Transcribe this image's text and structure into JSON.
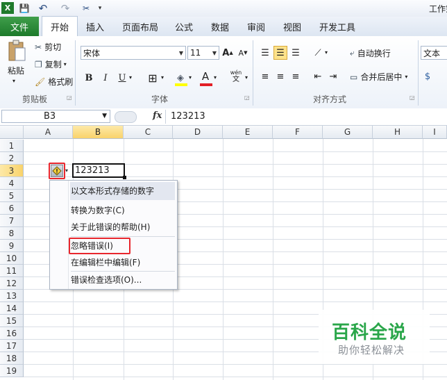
{
  "qat": {
    "save": "💾",
    "undo": "↶",
    "redo": "↷",
    "tools": "✂"
  },
  "window_title": "工作簿",
  "tabs": [
    {
      "label": "文件"
    },
    {
      "label": "开始"
    },
    {
      "label": "插入"
    },
    {
      "label": "页面布局"
    },
    {
      "label": "公式"
    },
    {
      "label": "数据"
    },
    {
      "label": "审阅"
    },
    {
      "label": "视图"
    },
    {
      "label": "开发工具"
    }
  ],
  "clipboard": {
    "paste": "粘贴",
    "cut": "剪切",
    "copy": "复制",
    "format_painter": "格式刷",
    "group": "剪贴板"
  },
  "font": {
    "name": "宋体",
    "size": "11",
    "bold": "B",
    "italic": "I",
    "underline": "U",
    "grow": "A",
    "shrink": "A",
    "font_color": "A",
    "wen": "wén",
    "group": "字体"
  },
  "alignment": {
    "wrap": "自动换行",
    "merge": "合并后居中",
    "group": "对齐方式"
  },
  "number": {
    "format": "文本"
  },
  "formula_bar": {
    "name_box": "B3",
    "fx": "fx",
    "value": "123213"
  },
  "columns": [
    "A",
    "B",
    "C",
    "D",
    "E",
    "F",
    "G",
    "H",
    "I"
  ],
  "rows": [
    "1",
    "2",
    "3",
    "4",
    "5",
    "6",
    "7",
    "8",
    "9",
    "10",
    "11",
    "12",
    "13",
    "14",
    "15",
    "16",
    "17",
    "18",
    "19"
  ],
  "cell_b3": "123213",
  "context_menu": {
    "header": "以文本形式存储的数字",
    "items": [
      "转换为数字(C)",
      "关于此错误的帮助(H)",
      "忽略错误(I)",
      "在编辑栏中编辑(F)",
      "错误检查选项(O)..."
    ]
  },
  "watermark": {
    "title": "百科全说",
    "subtitle": "助你轻松解决"
  },
  "colors": {
    "file_tab": "#1d7a2b",
    "selected_header": "#f9d36b",
    "highlight": "#e8262d",
    "watermark_green": "#2aa64a"
  }
}
